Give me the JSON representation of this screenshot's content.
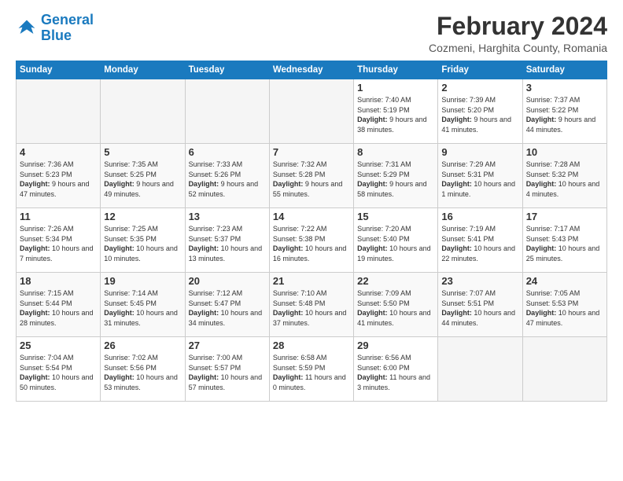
{
  "header": {
    "logo_text_general": "General",
    "logo_text_blue": "Blue",
    "month_year": "February 2024",
    "location": "Cozmeni, Harghita County, Romania"
  },
  "days_of_week": [
    "Sunday",
    "Monday",
    "Tuesday",
    "Wednesday",
    "Thursday",
    "Friday",
    "Saturday"
  ],
  "weeks": [
    [
      {
        "day": "",
        "empty": true
      },
      {
        "day": "",
        "empty": true
      },
      {
        "day": "",
        "empty": true
      },
      {
        "day": "",
        "empty": true
      },
      {
        "day": "1",
        "sunrise": "7:40 AM",
        "sunset": "5:19 PM",
        "daylight": "9 hours and 38 minutes."
      },
      {
        "day": "2",
        "sunrise": "7:39 AM",
        "sunset": "5:20 PM",
        "daylight": "9 hours and 41 minutes."
      },
      {
        "day": "3",
        "sunrise": "7:37 AM",
        "sunset": "5:22 PM",
        "daylight": "9 hours and 44 minutes."
      }
    ],
    [
      {
        "day": "4",
        "sunrise": "7:36 AM",
        "sunset": "5:23 PM",
        "daylight": "9 hours and 47 minutes."
      },
      {
        "day": "5",
        "sunrise": "7:35 AM",
        "sunset": "5:25 PM",
        "daylight": "9 hours and 49 minutes."
      },
      {
        "day": "6",
        "sunrise": "7:33 AM",
        "sunset": "5:26 PM",
        "daylight": "9 hours and 52 minutes."
      },
      {
        "day": "7",
        "sunrise": "7:32 AM",
        "sunset": "5:28 PM",
        "daylight": "9 hours and 55 minutes."
      },
      {
        "day": "8",
        "sunrise": "7:31 AM",
        "sunset": "5:29 PM",
        "daylight": "9 hours and 58 minutes."
      },
      {
        "day": "9",
        "sunrise": "7:29 AM",
        "sunset": "5:31 PM",
        "daylight": "10 hours and 1 minute."
      },
      {
        "day": "10",
        "sunrise": "7:28 AM",
        "sunset": "5:32 PM",
        "daylight": "10 hours and 4 minutes."
      }
    ],
    [
      {
        "day": "11",
        "sunrise": "7:26 AM",
        "sunset": "5:34 PM",
        "daylight": "10 hours and 7 minutes."
      },
      {
        "day": "12",
        "sunrise": "7:25 AM",
        "sunset": "5:35 PM",
        "daylight": "10 hours and 10 minutes."
      },
      {
        "day": "13",
        "sunrise": "7:23 AM",
        "sunset": "5:37 PM",
        "daylight": "10 hours and 13 minutes."
      },
      {
        "day": "14",
        "sunrise": "7:22 AM",
        "sunset": "5:38 PM",
        "daylight": "10 hours and 16 minutes."
      },
      {
        "day": "15",
        "sunrise": "7:20 AM",
        "sunset": "5:40 PM",
        "daylight": "10 hours and 19 minutes."
      },
      {
        "day": "16",
        "sunrise": "7:19 AM",
        "sunset": "5:41 PM",
        "daylight": "10 hours and 22 minutes."
      },
      {
        "day": "17",
        "sunrise": "7:17 AM",
        "sunset": "5:43 PM",
        "daylight": "10 hours and 25 minutes."
      }
    ],
    [
      {
        "day": "18",
        "sunrise": "7:15 AM",
        "sunset": "5:44 PM",
        "daylight": "10 hours and 28 minutes."
      },
      {
        "day": "19",
        "sunrise": "7:14 AM",
        "sunset": "5:45 PM",
        "daylight": "10 hours and 31 minutes."
      },
      {
        "day": "20",
        "sunrise": "7:12 AM",
        "sunset": "5:47 PM",
        "daylight": "10 hours and 34 minutes."
      },
      {
        "day": "21",
        "sunrise": "7:10 AM",
        "sunset": "5:48 PM",
        "daylight": "10 hours and 37 minutes."
      },
      {
        "day": "22",
        "sunrise": "7:09 AM",
        "sunset": "5:50 PM",
        "daylight": "10 hours and 41 minutes."
      },
      {
        "day": "23",
        "sunrise": "7:07 AM",
        "sunset": "5:51 PM",
        "daylight": "10 hours and 44 minutes."
      },
      {
        "day": "24",
        "sunrise": "7:05 AM",
        "sunset": "5:53 PM",
        "daylight": "10 hours and 47 minutes."
      }
    ],
    [
      {
        "day": "25",
        "sunrise": "7:04 AM",
        "sunset": "5:54 PM",
        "daylight": "10 hours and 50 minutes."
      },
      {
        "day": "26",
        "sunrise": "7:02 AM",
        "sunset": "5:56 PM",
        "daylight": "10 hours and 53 minutes."
      },
      {
        "day": "27",
        "sunrise": "7:00 AM",
        "sunset": "5:57 PM",
        "daylight": "10 hours and 57 minutes."
      },
      {
        "day": "28",
        "sunrise": "6:58 AM",
        "sunset": "5:59 PM",
        "daylight": "11 hours and 0 minutes."
      },
      {
        "day": "29",
        "sunrise": "6:56 AM",
        "sunset": "6:00 PM",
        "daylight": "11 hours and 3 minutes."
      },
      {
        "day": "",
        "empty": true
      },
      {
        "day": "",
        "empty": true
      }
    ]
  ]
}
